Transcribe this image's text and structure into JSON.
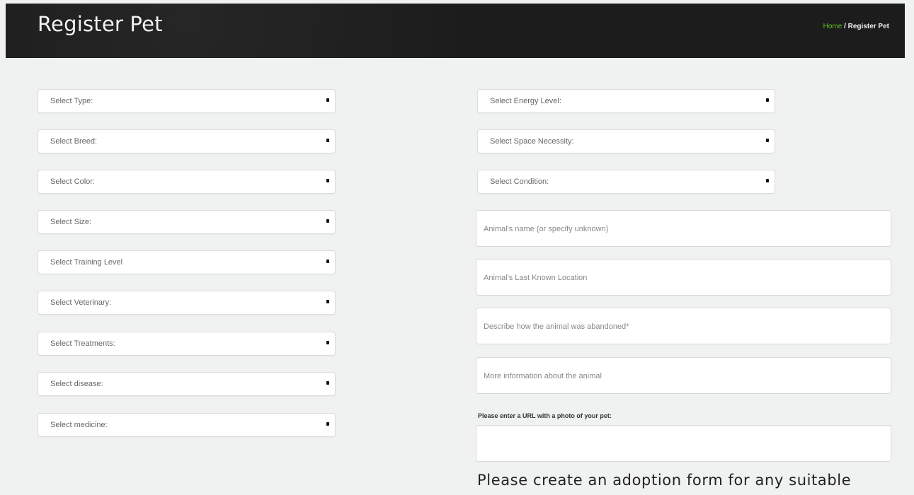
{
  "header": {
    "title": "Register Pet",
    "breadcrumb": {
      "home": "Home",
      "separator": " / ",
      "current": "Register Pet"
    }
  },
  "left_selects": [
    {
      "label": "Select Type:"
    },
    {
      "label": "Select Breed:"
    },
    {
      "label": "Select Color:"
    },
    {
      "label": "Select Size:"
    },
    {
      "label": "Select Training Level"
    },
    {
      "label": "Select Veterinary:"
    },
    {
      "label": "Select Treatments:"
    },
    {
      "label": "Select disease:"
    },
    {
      "label": "Select medicine:"
    }
  ],
  "right_selects": [
    {
      "label": "Select Energy Level:"
    },
    {
      "label": "Select Space Necessity:"
    },
    {
      "label": "Select Condition:"
    }
  ],
  "inputs": [
    {
      "placeholder": "Animal's name (or specify unknown)"
    },
    {
      "placeholder": "Animal's Last Known Location"
    },
    {
      "placeholder": "Describe how the animal was abandoned*"
    },
    {
      "placeholder": "More information about the animal"
    }
  ],
  "photo_url": {
    "label": "Please enter a URL with a photo of your pet:",
    "value": ""
  },
  "adoption_note": "Please create an adoption form for any suitable",
  "colors": {
    "header_bg": "#1c1c1c",
    "breadcrumb_home": "#5fc11e",
    "page_bg": "#f0f1f1"
  }
}
